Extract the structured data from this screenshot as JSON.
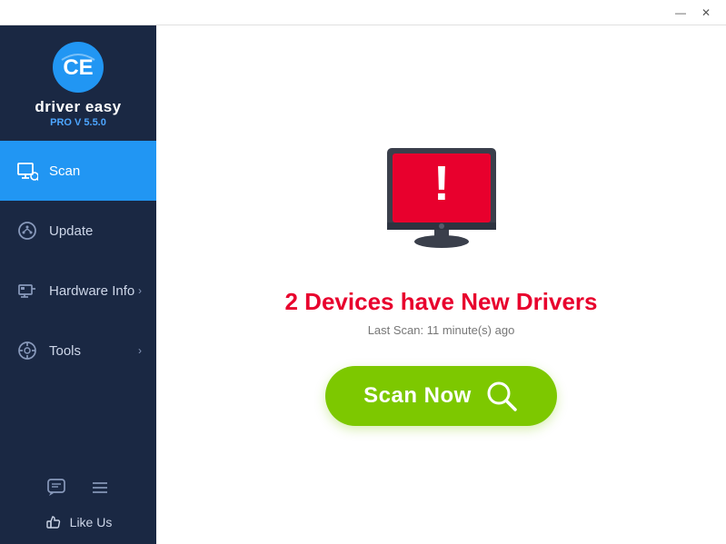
{
  "titleBar": {
    "minimizeLabel": "—",
    "closeLabel": "✕"
  },
  "sidebar": {
    "logoText": "driver easy",
    "version": "PRO V 5.5.0",
    "navItems": [
      {
        "id": "scan",
        "label": "Scan",
        "active": true,
        "hasChevron": false
      },
      {
        "id": "update",
        "label": "Update",
        "active": false,
        "hasChevron": false
      },
      {
        "id": "hardware-info",
        "label": "Hardware Info",
        "active": false,
        "hasChevron": true
      },
      {
        "id": "tools",
        "label": "Tools",
        "active": false,
        "hasChevron": true
      }
    ],
    "likeUs": "Like Us"
  },
  "main": {
    "statusHeading": "2 Devices have New Drivers",
    "lastScan": "Last Scan: 11 minute(s) ago",
    "scanNowLabel": "Scan Now"
  },
  "colors": {
    "accent": "#2196f3",
    "green": "#7dc800",
    "red": "#e8002d",
    "sidebar": "#1a2843"
  }
}
